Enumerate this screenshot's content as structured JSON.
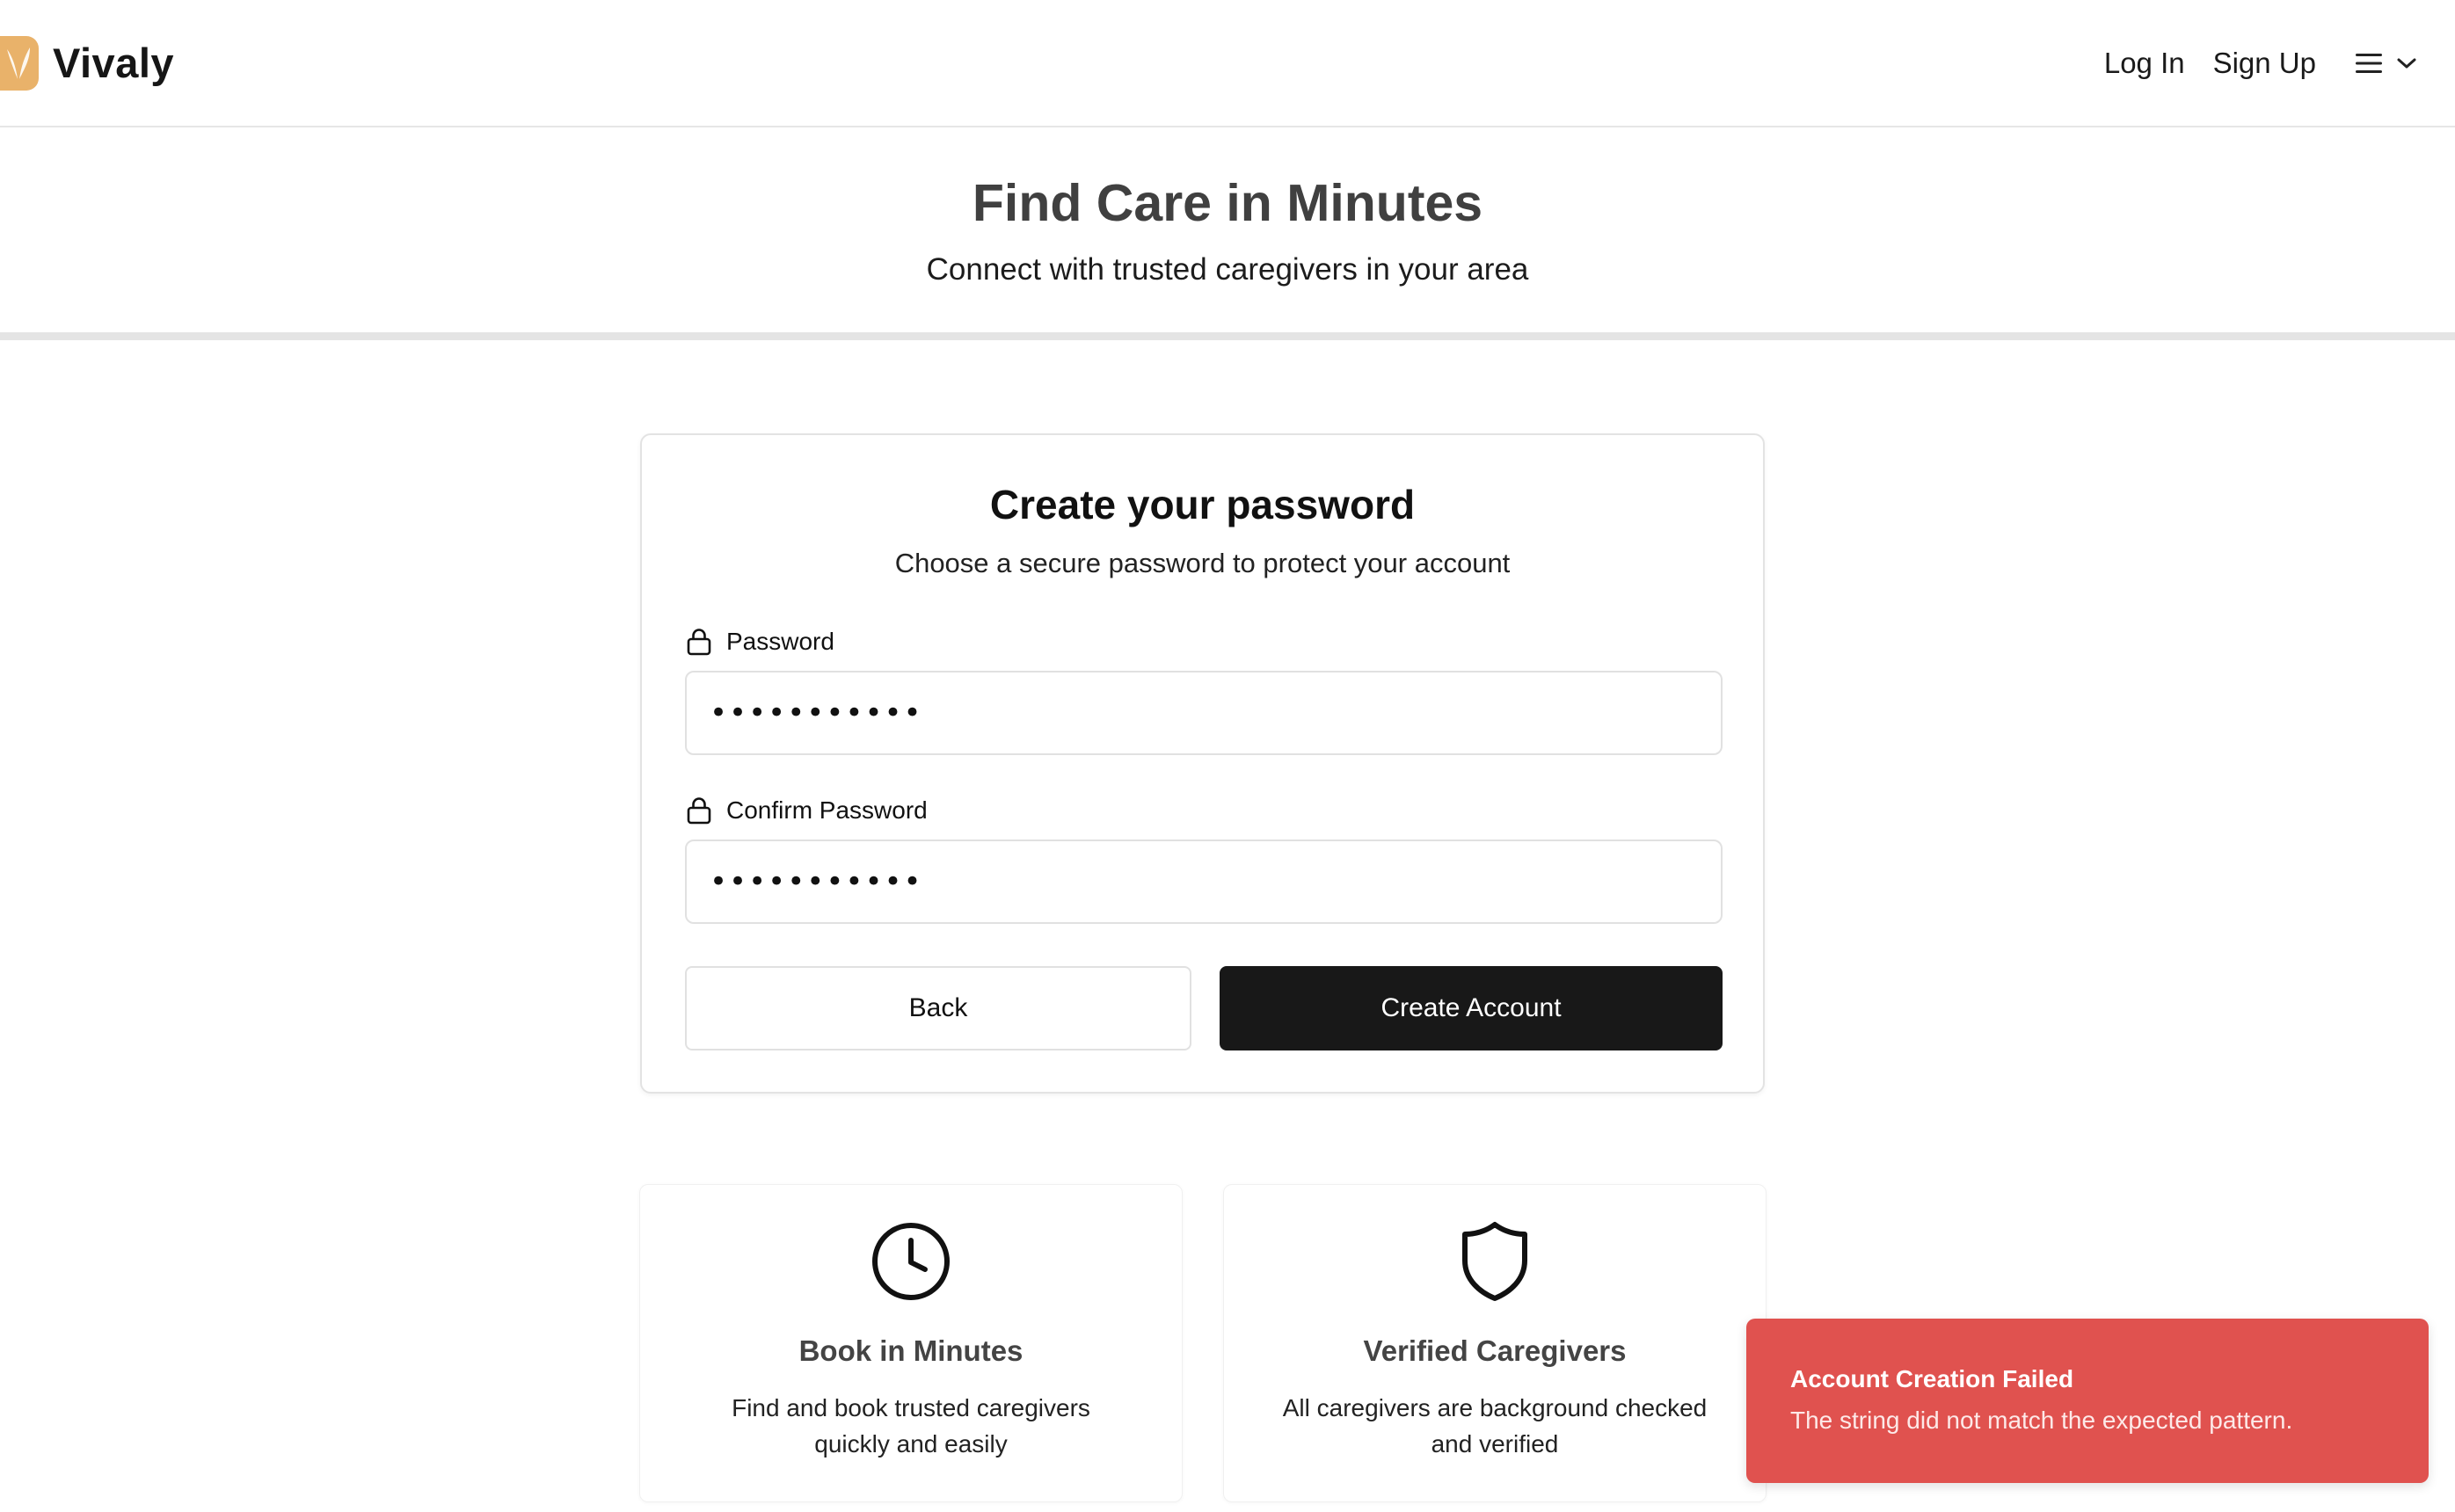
{
  "header": {
    "brand": "Vivaly",
    "login_label": "Log In",
    "signup_label": "Sign Up"
  },
  "hero": {
    "title": "Find Care in Minutes",
    "subtitle": "Connect with trusted caregivers in your area"
  },
  "form": {
    "title": "Create your password",
    "subtitle": "Choose a secure password to protect your account",
    "password_label": "Password",
    "password_value": "•••••••••••",
    "confirm_label": "Confirm Password",
    "confirm_value": "•••••••••••",
    "back_label": "Back",
    "create_label": "Create Account"
  },
  "features": [
    {
      "icon": "clock-icon",
      "title": "Book in Minutes",
      "description": "Find and book trusted caregivers quickly and easily"
    },
    {
      "icon": "shield-icon",
      "title": "Verified Caregivers",
      "description": "All caregivers are background checked and verified"
    }
  ],
  "toast": {
    "title": "Account Creation Failed",
    "message": "The string did not match the expected pattern."
  },
  "colors": {
    "brand": "#e9b26a",
    "primary_button": "#181818",
    "toast_error": "#e0524f"
  }
}
